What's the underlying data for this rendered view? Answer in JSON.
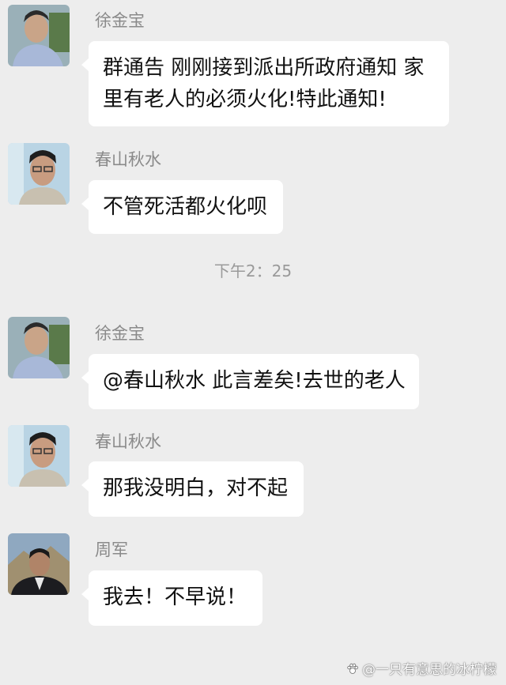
{
  "timestamp": "下午2：25",
  "messages": [
    {
      "sender": "徐金宝",
      "avatar": "man-avatar",
      "lines": [
        "群通告 刚刚接到派出所政府通知 家",
        "里有老人的必须火化!特此通知!"
      ]
    },
    {
      "sender": "春山秋水",
      "avatar": "man-glasses-avatar",
      "lines": [
        "不管死活都火化呗"
      ]
    },
    {
      "sender": "徐金宝",
      "avatar": "man-avatar",
      "lines": [
        "@春山秋水 此言差矣!去世的老人"
      ]
    },
    {
      "sender": "春山秋水",
      "avatar": "man-glasses-avatar",
      "lines": [
        "那我没明白，对不起"
      ]
    },
    {
      "sender": "周军",
      "avatar": "man-suit-avatar",
      "lines": [
        "我去！不早说！"
      ]
    }
  ],
  "watermark": {
    "prefix": "@",
    "text": "一只有意思的冰柠檬"
  },
  "colors": {
    "background": "#ededed",
    "bubble": "#ffffff",
    "sender_text": "#8a8a8a",
    "message_text": "#111111"
  }
}
